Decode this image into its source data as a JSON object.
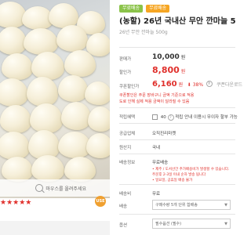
{
  "image": {
    "zoom_hint": "마우스를 올려주세요",
    "rating_badge": "USE"
  },
  "stars": "★★★★★",
  "badges": [
    "무료배송",
    "무료배송"
  ],
  "product": {
    "title": "(농할) 26년 국내산 무안 깐마늘 5",
    "subtitle": "26년 무안 깐마늘 500g"
  },
  "rows": {
    "list_price_label": "판매가",
    "list_price": "10,000",
    "sale_price_label": "할인가",
    "sale_price": "8,800",
    "coupon_label": "쿠폰할인가",
    "coupon_price": "6,160",
    "coupon_rate": "38%",
    "coupon_note": "쿠폰다운로드",
    "coupon_desc1": "쿠폰할인은 주문 장바구니 금액 기준으로 적용",
    "coupon_desc2": "도로 인해 실제 적용 금액이 달라질 수 있음",
    "points_label": "적립혜택",
    "points_value": "40",
    "points_note": "적립 안내",
    "points_desc": "이용시 무이자 할부 가능",
    "supplier_label": "공급업체",
    "supplier_value": "오직진리마켓",
    "origin_label": "원산지",
    "origin_value": "국내",
    "ship_info_label": "배송정보",
    "ship_info_value": "무료배송",
    "ship_desc1": "• 제주 / 도서산간 추가배송비가 발생할 수 있습니다.",
    "ship_desc2": "주문후 2-3일 이내 순차 발송 됩니다",
    "ship_desc3": "• 일요일, 공휴일 배송 불가",
    "shipfee_label": "배송비",
    "shipfee_value": "무료",
    "delivery_label": "배송",
    "delivery_value": "구매수량 5개 단위 합배송",
    "option_label": "옵션",
    "option_value": "필수옵션 (필수)"
  },
  "colors": {
    "accent_red": "#e0302c",
    "badge_green": "#8bc34a",
    "badge_orange": "#f6a623"
  }
}
